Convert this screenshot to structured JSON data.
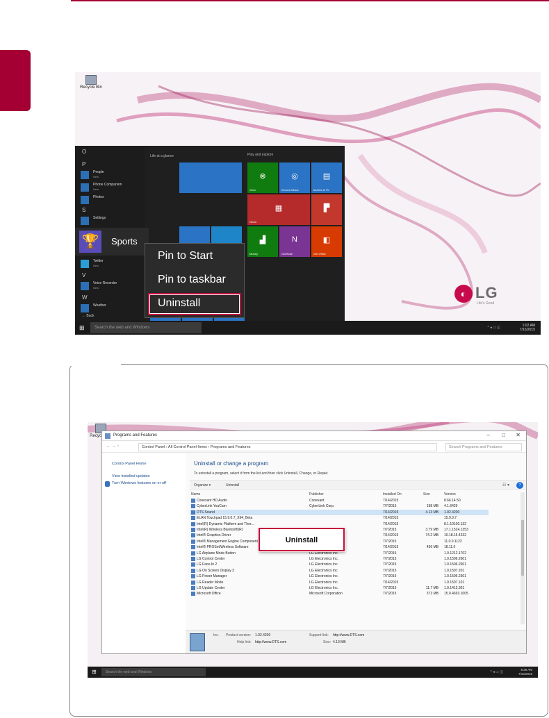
{
  "colors": {
    "brand": "#a50034",
    "highlight": "#c20a3a"
  },
  "screen1": {
    "desktop_icon_label": "Recycle Bin",
    "letters": [
      "O",
      "P",
      "S",
      "V",
      "W"
    ],
    "apps": [
      {
        "name": "People",
        "sub": "New"
      },
      {
        "name": "Phone Companion",
        "sub": "New"
      },
      {
        "name": "Photos",
        "sub": ""
      },
      {
        "name": "Settings",
        "sub": ""
      },
      {
        "name": "Twitter",
        "sub": "New"
      },
      {
        "name": "Voice Recorder",
        "sub": "New"
      },
      {
        "name": "Weather",
        "sub": ""
      }
    ],
    "back_label": "Back",
    "sports_label": "Sports",
    "group_life": "Life at a glance",
    "group_play": "Play and explore",
    "group_lg": "LG",
    "tiles": {
      "xbox": "Xbox",
      "groove": "Groove Music",
      "movies": "Movies & TV",
      "news": "News",
      "phone": "Phone Compan...",
      "money": "Money",
      "onenote": "OneNote",
      "office": "Get Office",
      "store": "Store"
    },
    "context_menu": [
      "Pin to Start",
      "Pin to taskbar",
      "Uninstall"
    ],
    "taskbar_search": "Search the web and Windows",
    "clock_time": "1:02 AM",
    "clock_date": "7/15/2015",
    "logo_text": "LG",
    "logo_tagline": "Life's Good"
  },
  "screen2": {
    "desktop_icon_label": "Recycle Bin",
    "window_title": "Programs and Features",
    "breadcrumb": "Control Panel  ›  All Control Panel Items  ›  Programs and Features",
    "search_placeholder": "Search Programs and Features",
    "left_links": [
      "Control Panel Home",
      "View installed updates",
      "Turn Windows features on or off"
    ],
    "heading": "Uninstall or change a program",
    "description": "To uninstall a program, select it from the list and then click Uninstall, Change, or Repair.",
    "toolbar": {
      "organize": "Organize ▾",
      "uninstall": "Uninstall"
    },
    "columns": {
      "name": "Name",
      "publisher": "Publisher",
      "installed_on": "Installed On",
      "size": "Size",
      "version": "Version"
    },
    "rows": [
      {
        "name": "Conexant HD Audio",
        "publisher": "Conexant",
        "date": "7/14/2015",
        "size": "",
        "version": "8.66.14.50"
      },
      {
        "name": "CyberLink YouCam",
        "publisher": "CyberLink Corp.",
        "date": "7/7/2015",
        "size": "198 MB",
        "version": "4.1.6429"
      },
      {
        "name": "DTS Sound",
        "publisher": "",
        "date": "7/14/2015",
        "size": "4.13 MB",
        "version": "1.02.4200"
      },
      {
        "name": "ELAN Touchpad 15.9.0.7_X64_Beta",
        "publisher": "",
        "date": "7/14/2015",
        "size": "",
        "version": "15.9.0.7"
      },
      {
        "name": "Intel(R) Dynamic Platform and Ther...",
        "publisher": "",
        "date": "7/14/2015",
        "size": "",
        "version": "8.1.10100.132"
      },
      {
        "name": "Intel(R) Wireless Bluetooth(R)",
        "publisher": "",
        "date": "7/7/2015",
        "size": "3.79 MB",
        "version": "17.1.1524.1353"
      },
      {
        "name": "Intel® Graphics Driver",
        "publisher": "Intel Corporation",
        "date": "7/14/2015",
        "size": "74.2 MB",
        "version": "10.18.15.4232"
      },
      {
        "name": "Intel® Management Engine Components",
        "publisher": "Intel Corporation",
        "date": "7/7/2015",
        "size": "",
        "version": "11.0.0.1122"
      },
      {
        "name": "Intel® PROSet/Wireless Software",
        "publisher": "Intel Corporation",
        "date": "7/14/2015",
        "size": "436 MB",
        "version": "18.11.0"
      },
      {
        "name": "LG Airplane Mode Button",
        "publisher": "LG Electronics Inc.",
        "date": "7/7/2015",
        "size": "",
        "version": "1.0.1212.1702"
      },
      {
        "name": "LG Control Center",
        "publisher": "LG Electronics Inc.",
        "date": "7/7/2015",
        "size": "",
        "version": "1.0.1506.2601"
      },
      {
        "name": "LG Face-In 2",
        "publisher": "LG Electronics Inc.",
        "date": "7/7/2015",
        "size": "",
        "version": "1.0.1506.2601"
      },
      {
        "name": "LG On Screen Display 3",
        "publisher": "LG Electronics Inc.",
        "date": "7/7/2015",
        "size": "",
        "version": "1.0.1507.201"
      },
      {
        "name": "LG Power Manager",
        "publisher": "LG Electronics Inc.",
        "date": "7/7/2015",
        "size": "",
        "version": "1.0.1506.2301"
      },
      {
        "name": "LG Reader Mode",
        "publisher": "LG Electronics Inc.",
        "date": "7/14/2015",
        "size": "",
        "version": "1.0.1507.101"
      },
      {
        "name": "LG Update Center",
        "publisher": "LG Electronics Inc.",
        "date": "7/7/2015",
        "size": "11.7 MB",
        "version": "1.0.1412.301"
      },
      {
        "name": "Microsoft Office",
        "publisher": "Microsoft Corporation",
        "date": "7/7/2015",
        "size": "373 MB",
        "version": "15.0.4693.1005"
      }
    ],
    "details": {
      "publisher": "Inc.",
      "product_version_label": "Product version:",
      "product_version": "1.02.4200",
      "support_link_label": "Support link:",
      "support_link": "http://www.DTS.com",
      "help_link_label": "Help link:",
      "help_link": "http://www.DTS.com",
      "size_label": "Size:",
      "size": "4.13 MB"
    },
    "popup_label": "Uninstall",
    "taskbar_search": "Search the web and Windows",
    "clock_time": "8:26 AM",
    "clock_date": "7/15/2015"
  }
}
